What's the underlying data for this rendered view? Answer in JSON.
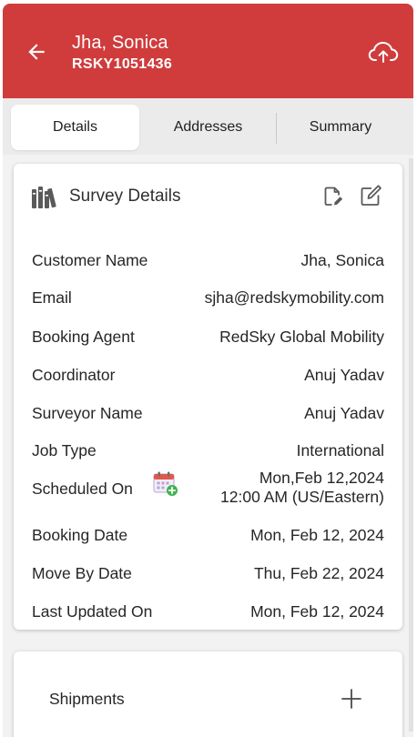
{
  "header": {
    "name": "Jha, Sonica",
    "id": "RSKY1051436",
    "back_icon": "arrow-left-icon",
    "upload_icon": "cloud-upload-icon",
    "bg_color": "#d03c3c"
  },
  "tabs": [
    {
      "label": "Details",
      "active": true
    },
    {
      "label": "Addresses",
      "active": false
    },
    {
      "label": "Summary",
      "active": false
    }
  ],
  "survey_details": {
    "title": "Survey Details",
    "icons": [
      "books-icon",
      "document-edit-icon",
      "edit-icon"
    ],
    "rows": [
      {
        "label": "Customer Name",
        "value": "Jha, Sonica"
      },
      {
        "label": "Email",
        "value": "sjha@redskymobility.com"
      },
      {
        "label": "Booking Agent",
        "value": "RedSky Global Mobility"
      },
      {
        "label": "Coordinator",
        "value": "Anuj Yadav"
      },
      {
        "label": "Surveyor Name",
        "value": "Anuj Yadav"
      },
      {
        "label": "Job Type",
        "value": "International"
      },
      {
        "label": "Scheduled On",
        "value": "Mon,Feb 12,2024",
        "value_line2": "12:00 AM (US/Eastern)",
        "icon": "calendar-add-icon"
      },
      {
        "label": "Booking Date",
        "value": "Mon, Feb 12, 2024"
      },
      {
        "label": "Move By Date",
        "value": "Thu, Feb 22, 2024"
      },
      {
        "label": "Last Updated On",
        "value": "Mon, Feb 12, 2024"
      }
    ]
  },
  "shipments": {
    "title": "Shipments",
    "add_icon": "plus-icon"
  }
}
